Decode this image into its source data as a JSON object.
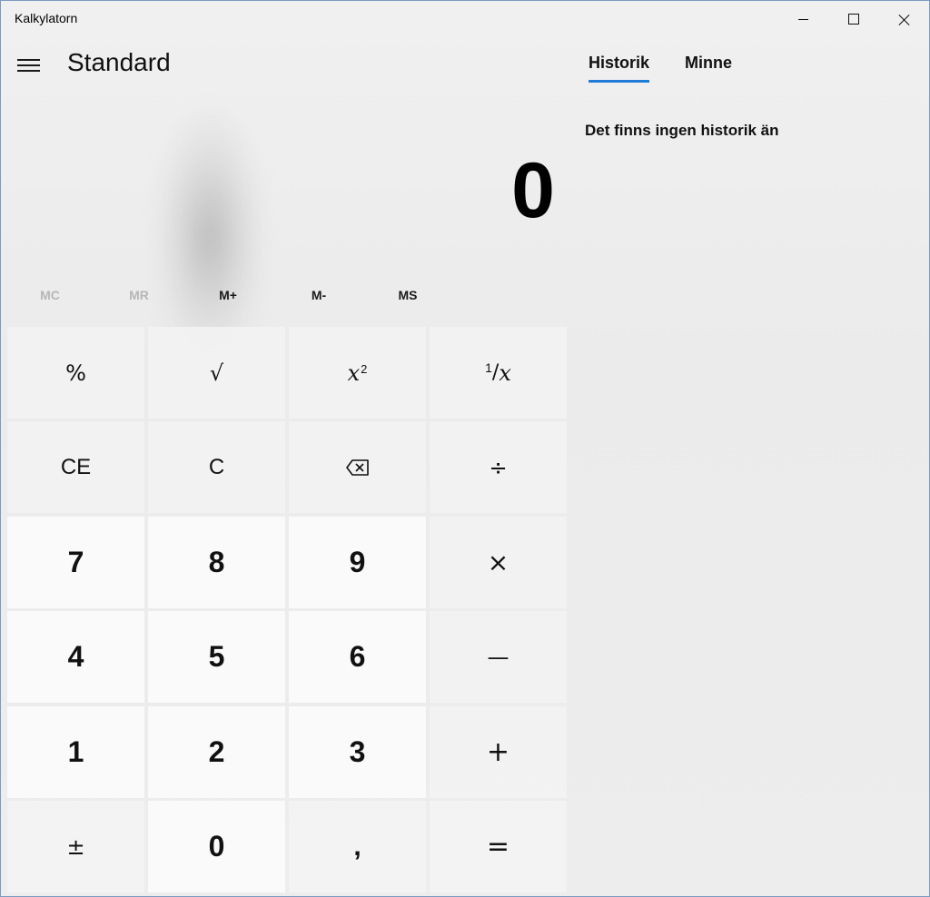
{
  "window": {
    "title": "Kalkylatorn",
    "accent_color": "#1e7bd6",
    "controls": [
      "minimize-icon",
      "maximize-icon",
      "close-icon"
    ]
  },
  "header": {
    "menu_icon": "hamburger-icon",
    "mode": "Standard"
  },
  "display": {
    "value": "0"
  },
  "memory": {
    "buttons": [
      {
        "label": "MC",
        "enabled": false
      },
      {
        "label": "MR",
        "enabled": false
      },
      {
        "label": "M+",
        "enabled": true
      },
      {
        "label": "M-",
        "enabled": true
      },
      {
        "label": "MS",
        "enabled": true
      }
    ]
  },
  "keypad": {
    "percent": "%",
    "sqrt": "√",
    "square_base": "x",
    "square_exp": "2",
    "recip_num": "1",
    "recip_slash": "/",
    "recip_den": "x",
    "ce": "CE",
    "c": "C",
    "backspace_icon": "backspace-icon",
    "divide": "÷",
    "d7": "7",
    "d8": "8",
    "d9": "9",
    "multiply": "×",
    "d4": "4",
    "d5": "5",
    "d6": "6",
    "minus": "—",
    "d1": "1",
    "d2": "2",
    "d3": "3",
    "plus": "+",
    "negate": "±",
    "d0": "0",
    "decimal": ",",
    "equals": "="
  },
  "panel": {
    "tabs": [
      {
        "label": "Historik",
        "active": true
      },
      {
        "label": "Minne",
        "active": false
      }
    ],
    "empty_message": "Det finns ingen historik än"
  }
}
